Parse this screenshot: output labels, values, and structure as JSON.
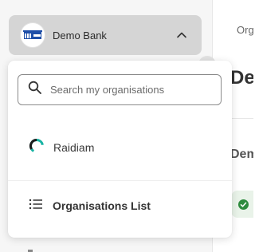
{
  "org_switcher": {
    "name": "Demo Bank",
    "logo_icon": "bank-logo-icon",
    "chevron_icon": "chevron-up-icon"
  },
  "dropdown": {
    "search": {
      "placeholder": "Search my organisations",
      "value": ""
    },
    "organisations": [
      {
        "label": "Raidiam",
        "icon": "raidiam-logo-icon"
      }
    ],
    "list_link": {
      "label": "Organisations List",
      "icon": "list-icon"
    }
  },
  "content": {
    "breadcrumb": "Org",
    "heading": "Det",
    "subheading": "Dem",
    "status_icon": "check-circle-icon"
  },
  "colors": {
    "switcher_bg": "#d5d5d5",
    "sidebar_bg": "#f6f6f6",
    "status_green": "#2e8b3e",
    "raidiam_teal": "#17b3a3"
  }
}
